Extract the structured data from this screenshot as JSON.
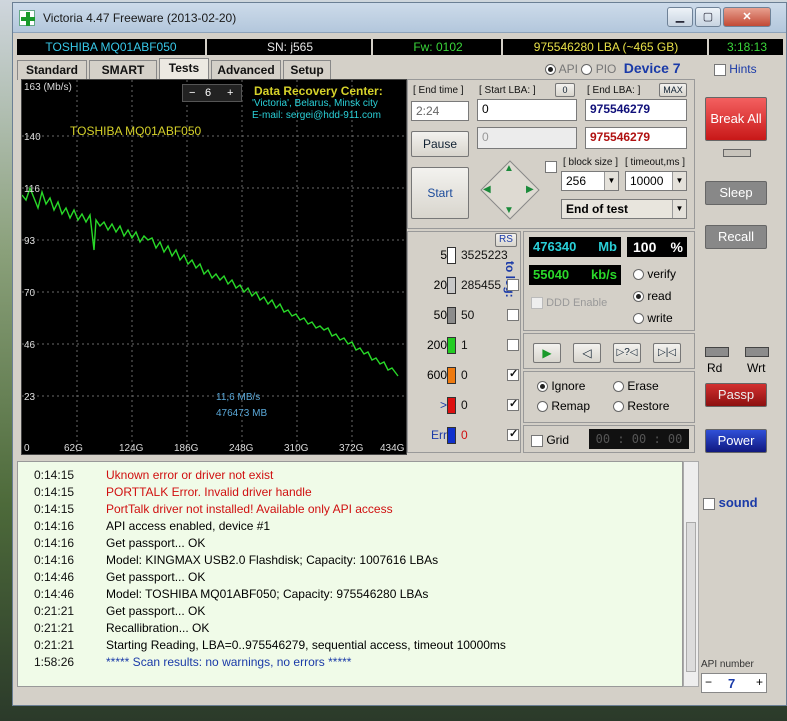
{
  "window": {
    "title": "Victoria 4.47  Freeware (2013-02-20)"
  },
  "info": {
    "model": "TOSHIBA MQ01ABF050",
    "sn": "SN: j565",
    "fw": "Fw: 0102",
    "lba": "975546280 LBA (~465 GB)",
    "time": "3:18:13"
  },
  "tabs": [
    "Standard",
    "SMART",
    "Tests",
    "Advanced",
    "Setup"
  ],
  "api": {
    "api_label": "API",
    "pio_label": "PIO",
    "device": "Device 7",
    "hints": "Hints"
  },
  "graph": {
    "ymax_label": "163 (Mb/s)",
    "yticks": [
      "140",
      "116",
      "93",
      "70",
      "46",
      "23",
      "0"
    ],
    "xticks": [
      "62G",
      "124G",
      "186G",
      "248G",
      "310G",
      "372G",
      "434G"
    ],
    "scale_value": "6",
    "drive": "TOSHIBA MQ01ABF050",
    "center_title": "Data Recovery Center:",
    "center_line1": "'Victoria', Belarus, Minsk city",
    "center_line2": "E-mail: sergei@hdd-911.com",
    "speed": "11,6 MB/s",
    "pos": "476473 MB"
  },
  "controls": {
    "end_time_label": "[ End time ]",
    "start_lba_label": "[ Start LBA: ]",
    "start_zero": "0",
    "end_lba_label": "[ End LBA: ]",
    "max_label": "MAX",
    "end_time": "2:24",
    "start_lba": "0",
    "end_lba": "975546279",
    "cur_lba": "0",
    "end_lba2": "975546279",
    "pause": "Pause",
    "start": "Start",
    "block_label": "[ block size ]",
    "timeout_label": "[ timeout,ms ]",
    "block": "256",
    "timeout": "10000",
    "end_of_test": "End of test"
  },
  "counters": [
    {
      "ms": "5",
      "value": "3525223",
      "color": "#ffffff"
    },
    {
      "ms": "20",
      "value": "285455",
      "color": "#c8c8c8"
    },
    {
      "ms": "50",
      "value": "50",
      "color": "#8c8c8c"
    },
    {
      "ms": "200",
      "value": "1",
      "color": "#22cc22"
    },
    {
      "ms": "600",
      "value": "0",
      "color": "#ee7a10"
    },
    {
      "ms": ">",
      "value": "0",
      "color": "#dd1010"
    },
    {
      "ms": "Err",
      "value": "0",
      "color": "#1030cc"
    }
  ],
  "rs": "RS",
  "to_log": "to log:",
  "stats": {
    "mb": "476340",
    "mb_unit": "Mb",
    "pct": "100",
    "pct_unit": "%",
    "kbs": "55040",
    "kbs_unit": "kb/s"
  },
  "modes": {
    "verify": "verify",
    "read": "read",
    "write": "write",
    "ddd": "DDD Enable"
  },
  "actions": {
    "ignore": "Ignore",
    "erase": "Erase",
    "remap": "Remap",
    "restore": "Restore",
    "grid": "Grid",
    "grid_time": "00 : 00 : 00"
  },
  "side": {
    "break_all": "Break All",
    "sleep": "Sleep",
    "recall": "Recall",
    "rd": "Rd",
    "wrt": "Wrt",
    "passp": "Passp",
    "power": "Power",
    "sound": "sound",
    "api_number_label": "API number",
    "api_number": "7"
  },
  "log": [
    {
      "t": "0:14:15",
      "m": "Uknown error or driver not exist",
      "c": "#d01010"
    },
    {
      "t": "0:14:15",
      "m": "PORTTALK Error. Invalid driver handle",
      "c": "#d01010"
    },
    {
      "t": "0:14:15",
      "m": "PortTalk driver not installed! Available only API access",
      "c": "#d01010"
    },
    {
      "t": "0:14:16",
      "m": "API access enabled, device #1",
      "c": "#111111"
    },
    {
      "t": "0:14:16",
      "m": "Get passport... OK",
      "c": "#111111"
    },
    {
      "t": "0:14:16",
      "m": "Model: KINGMAX USB2.0 Flashdisk; Capacity: 1007616 LBAs",
      "c": "#111111"
    },
    {
      "t": "0:14:46",
      "m": "Get passport... OK",
      "c": "#111111"
    },
    {
      "t": "0:14:46",
      "m": "Model: TOSHIBA MQ01ABF050; Capacity: 975546280 LBAs",
      "c": "#111111"
    },
    {
      "t": "0:21:21",
      "m": "Get passport... OK",
      "c": "#111111"
    },
    {
      "t": "0:21:21",
      "m": "Recallibration... OK",
      "c": "#111111"
    },
    {
      "t": "0:21:21",
      "m": "Starting Reading, LBA=0..975546279, sequential access, timeout 10000ms",
      "c": "#111111"
    },
    {
      "t": "1:58:26",
      "m": "***** Scan results: no warnings, no errors *****",
      "c": "#1a3aa8"
    }
  ]
}
